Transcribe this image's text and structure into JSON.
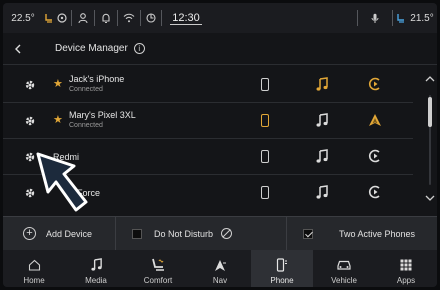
{
  "status_bar": {
    "temp_left": "22.5°",
    "time": "12:30",
    "temp_right": "21.5°"
  },
  "header": {
    "title": "Device Manager",
    "info": "i"
  },
  "devices": [
    {
      "name": "Jack's iPhone",
      "status": "Connected",
      "favorite": true,
      "phone_active": false,
      "control_icon": "play-circle-icon"
    },
    {
      "name": "Mary's Pixel 3XL",
      "status": "Connected",
      "favorite": true,
      "phone_active": true,
      "control_icon": "android-auto-icon"
    },
    {
      "name": "Redmi",
      "status": "",
      "favorite": false,
      "phone_active": false,
      "control_icon": "play-circle-icon"
    },
    {
      "name": "Z Force",
      "status": "",
      "favorite": false,
      "phone_active": false,
      "control_icon": "play-circle-icon"
    }
  ],
  "actions": {
    "add_device": "Add Device",
    "do_not_disturb": "Do Not Disturb",
    "two_active_phones": "Two Active Phones",
    "two_active_checked": true,
    "dnd_checked": false
  },
  "nav": [
    {
      "label": "Home",
      "icon": "home-icon"
    },
    {
      "label": "Media",
      "icon": "music-note-icon"
    },
    {
      "label": "Comfort",
      "icon": "seat-icon"
    },
    {
      "label": "Nav",
      "icon": "navigation-arrow-icon"
    },
    {
      "label": "Phone",
      "icon": "phone-icon",
      "active": true
    },
    {
      "label": "Vehicle",
      "icon": "car-icon"
    },
    {
      "label": "Apps",
      "icon": "grid-icon"
    }
  ],
  "colors": {
    "accent": "#e2a737",
    "background": "#141518",
    "action_bar": "#26282c"
  }
}
